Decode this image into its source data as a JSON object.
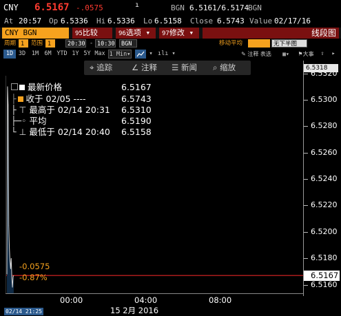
{
  "header": {
    "ticker": "CNY",
    "last_price": "6.5167",
    "change": "-.0575",
    "source1": "BGN",
    "bid_ask": "6.5161/6.5174",
    "source2": "BGN",
    "at_label": "At",
    "at_time": "20:57",
    "op_label": "Op",
    "open": "6.5336",
    "hi_label": "Hi",
    "high": "6.5336",
    "lo_label": "Lo",
    "low": "6.5158",
    "close_label": "Close",
    "close": "6.5743",
    "value_label": "Value",
    "value_date": "02/17/16"
  },
  "toolbar": {
    "security": "CNY BGN Curncy",
    "compare_num": "95",
    "compare_label": "比较",
    "options_num": "96",
    "options_label": "选项",
    "edit_num": "97",
    "edit_label": "修改",
    "chart_type": "线段图"
  },
  "settings": {
    "period_label": "周期",
    "period_value": "1",
    "range_label": "范围",
    "range_value": "1",
    "time_from": "20:30",
    "time_to": "10:30",
    "source": "BGN",
    "ma_label": "移动平均",
    "ma_value": "无下半图"
  },
  "zoom": {
    "buttons": [
      "1D",
      "3D",
      "1M",
      "6M",
      "YTD",
      "1Y",
      "5Y",
      "Max"
    ],
    "selected": "1D",
    "interval": "1 Min",
    "tools_label": "注释 表选",
    "big_label": "大事"
  },
  "actions": {
    "track": "追踪",
    "annotate": "注释",
    "news": "新闻",
    "zoom": "缩放"
  },
  "legend": [
    {
      "label": "最新价格",
      "value": "6.5167"
    },
    {
      "label": "收于 02/05 ----",
      "value": "6.5743"
    },
    {
      "label": "最高于 02/14 20:31",
      "value": "6.5310"
    },
    {
      "label": "平均",
      "value": "6.5190"
    },
    {
      "label": "最低于 02/14 20:40",
      "value": "6.5158"
    }
  ],
  "chart_data": {
    "type": "line",
    "y_ticks": [
      "6.5320",
      "6.5300",
      "6.5280",
      "6.5260",
      "6.5240",
      "6.5220",
      "6.5200",
      "6.5180",
      "6.5160"
    ],
    "ylim": [
      6.5153,
      6.5325
    ],
    "x_ticks": [
      "00:00",
      "04:00",
      "08:00"
    ],
    "x_date_label": "15 2月 2016",
    "timestamp": "02/14 21:25",
    "top_marker": "6.5318",
    "current_marker": "6.5167",
    "current_level": 6.5167,
    "change_abs": "-0.0575",
    "change_pct": "-0.87%",
    "series": [
      {
        "x": [
          "20:30",
          "20:31",
          "20:32",
          "20:33",
          "20:34",
          "20:35",
          "20:36",
          "20:37",
          "20:38",
          "20:40",
          "20:42",
          "20:45"
        ],
        "values": [
          6.5168,
          6.531,
          6.5296,
          6.5205,
          6.5188,
          6.5178,
          6.5172,
          6.518,
          6.5165,
          6.5158,
          6.5166,
          6.5167
        ]
      }
    ],
    "colors": {
      "line": "#d8d8d8",
      "current": "#ff2a2a",
      "area": "#0f2a45",
      "accent": "#f6a21e"
    }
  }
}
